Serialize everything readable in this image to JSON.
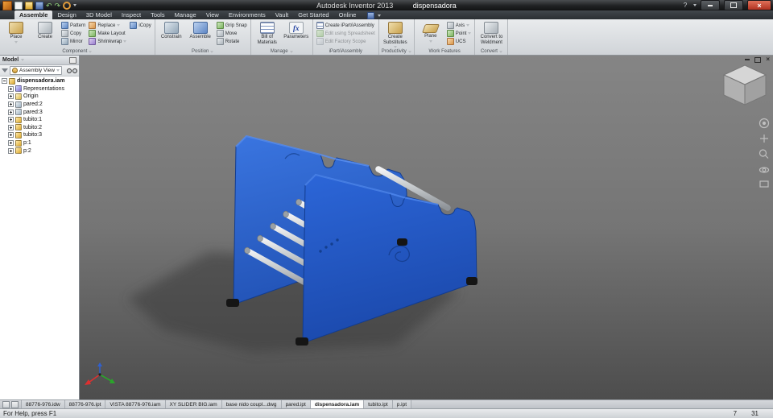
{
  "titlebar": {
    "app_title": "Autodesk Inventor 2013",
    "doc_title": "dispensadora"
  },
  "icons": {
    "fx": "fx",
    "help": "?",
    "close": "×"
  },
  "menu_tabs": {
    "items": [
      {
        "label": "Assemble"
      },
      {
        "label": "Design"
      },
      {
        "label": "3D Model"
      },
      {
        "label": "Inspect"
      },
      {
        "label": "Tools"
      },
      {
        "label": "Manage"
      },
      {
        "label": "View"
      },
      {
        "label": "Environments"
      },
      {
        "label": "Vault"
      },
      {
        "label": "Get Started"
      },
      {
        "label": "Online"
      }
    ]
  },
  "ribbon": {
    "component": {
      "label": "Component",
      "big": [
        {
          "label": "Place"
        },
        {
          "label": "Create"
        }
      ],
      "col1": [
        {
          "label": "Pattern"
        },
        {
          "label": "Copy"
        },
        {
          "label": "Mirror"
        }
      ],
      "col2": [
        {
          "label": "Replace"
        },
        {
          "label": "Make Layout"
        },
        {
          "label": "Shrinkwrap"
        }
      ],
      "col3": [
        {
          "label": "iCopy"
        }
      ]
    },
    "position": {
      "label": "Position",
      "big": [
        {
          "label": "Constrain"
        },
        {
          "label": "Assemble"
        }
      ],
      "col1": [
        {
          "label": "Grip Snap"
        },
        {
          "label": "Move"
        },
        {
          "label": "Rotate"
        }
      ]
    },
    "manage": {
      "label": "Manage",
      "big": [
        {
          "label": "Bill of Materials"
        },
        {
          "label": "Parameters"
        }
      ]
    },
    "ipart": {
      "label": "iPart/iAssembly",
      "col1": [
        {
          "label": "Create iPart/iAssembly"
        },
        {
          "label": "Edit using Spreadsheet"
        },
        {
          "label": "Edit Factory Scope"
        }
      ]
    },
    "productivity": {
      "label": "Productivity",
      "big": [
        {
          "label": "Create Substitutes"
        }
      ]
    },
    "work_features": {
      "label": "Work Features",
      "big": [
        {
          "label": "Plane"
        }
      ],
      "col1": [
        {
          "label": "Axis"
        },
        {
          "label": "Point"
        },
        {
          "label": "UCS"
        }
      ]
    },
    "convert": {
      "label": "Convert",
      "big": [
        {
          "label": "Convert to Weldment"
        }
      ]
    }
  },
  "browser": {
    "panel_title": "Model",
    "view_mode": "Assembly View",
    "tree": [
      {
        "label": "dispensadora.iam"
      },
      {
        "label": "Representations"
      },
      {
        "label": "Origin"
      },
      {
        "label": "pared:2"
      },
      {
        "label": "pared:3"
      },
      {
        "label": "tubito:1"
      },
      {
        "label": "tubito:2"
      },
      {
        "label": "tubito:3"
      },
      {
        "label": "p:1"
      },
      {
        "label": "p:2"
      }
    ]
  },
  "doc_tabs": {
    "items": [
      {
        "label": "88776-976.idw"
      },
      {
        "label": "88776-976.ipt"
      },
      {
        "label": "VISTA 88776-976.iam"
      },
      {
        "label": "XY SLIDER BIG.iam"
      },
      {
        "label": "base nido coupl...dwg"
      },
      {
        "label": "pared.ipt"
      },
      {
        "label": "dispensadora.iam"
      },
      {
        "label": "tubito.ipt"
      },
      {
        "label": "p.ipt"
      }
    ]
  },
  "statusbar": {
    "help_text": "For Help, press F1",
    "left_num": "7",
    "right_num": "31"
  },
  "colors": {
    "model_blue": "#2256c8",
    "model_blue_dark": "#1b4aae",
    "model_blue_light": "#3a76e2",
    "rod_silver": "#c6cacd",
    "viewport_top": "#848484",
    "viewport_bottom": "#4e4e4e"
  }
}
